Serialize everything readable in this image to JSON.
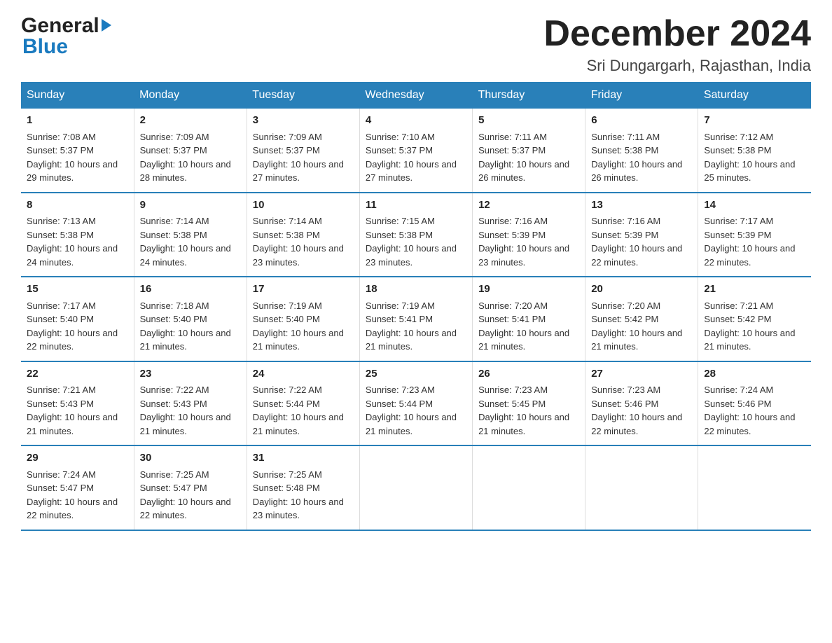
{
  "logo": {
    "line1": "General",
    "line2": "Blue"
  },
  "title": "December 2024",
  "location": "Sri Dungargarh, Rajasthan, India",
  "weekdays": [
    "Sunday",
    "Monday",
    "Tuesday",
    "Wednesday",
    "Thursday",
    "Friday",
    "Saturday"
  ],
  "weeks": [
    [
      {
        "day": "1",
        "sunrise": "7:08 AM",
        "sunset": "5:37 PM",
        "daylight": "10 hours and 29 minutes."
      },
      {
        "day": "2",
        "sunrise": "7:09 AM",
        "sunset": "5:37 PM",
        "daylight": "10 hours and 28 minutes."
      },
      {
        "day": "3",
        "sunrise": "7:09 AM",
        "sunset": "5:37 PM",
        "daylight": "10 hours and 27 minutes."
      },
      {
        "day": "4",
        "sunrise": "7:10 AM",
        "sunset": "5:37 PM",
        "daylight": "10 hours and 27 minutes."
      },
      {
        "day": "5",
        "sunrise": "7:11 AM",
        "sunset": "5:37 PM",
        "daylight": "10 hours and 26 minutes."
      },
      {
        "day": "6",
        "sunrise": "7:11 AM",
        "sunset": "5:38 PM",
        "daylight": "10 hours and 26 minutes."
      },
      {
        "day": "7",
        "sunrise": "7:12 AM",
        "sunset": "5:38 PM",
        "daylight": "10 hours and 25 minutes."
      }
    ],
    [
      {
        "day": "8",
        "sunrise": "7:13 AM",
        "sunset": "5:38 PM",
        "daylight": "10 hours and 24 minutes."
      },
      {
        "day": "9",
        "sunrise": "7:14 AM",
        "sunset": "5:38 PM",
        "daylight": "10 hours and 24 minutes."
      },
      {
        "day": "10",
        "sunrise": "7:14 AM",
        "sunset": "5:38 PM",
        "daylight": "10 hours and 23 minutes."
      },
      {
        "day": "11",
        "sunrise": "7:15 AM",
        "sunset": "5:38 PM",
        "daylight": "10 hours and 23 minutes."
      },
      {
        "day": "12",
        "sunrise": "7:16 AM",
        "sunset": "5:39 PM",
        "daylight": "10 hours and 23 minutes."
      },
      {
        "day": "13",
        "sunrise": "7:16 AM",
        "sunset": "5:39 PM",
        "daylight": "10 hours and 22 minutes."
      },
      {
        "day": "14",
        "sunrise": "7:17 AM",
        "sunset": "5:39 PM",
        "daylight": "10 hours and 22 minutes."
      }
    ],
    [
      {
        "day": "15",
        "sunrise": "7:17 AM",
        "sunset": "5:40 PM",
        "daylight": "10 hours and 22 minutes."
      },
      {
        "day": "16",
        "sunrise": "7:18 AM",
        "sunset": "5:40 PM",
        "daylight": "10 hours and 21 minutes."
      },
      {
        "day": "17",
        "sunrise": "7:19 AM",
        "sunset": "5:40 PM",
        "daylight": "10 hours and 21 minutes."
      },
      {
        "day": "18",
        "sunrise": "7:19 AM",
        "sunset": "5:41 PM",
        "daylight": "10 hours and 21 minutes."
      },
      {
        "day": "19",
        "sunrise": "7:20 AM",
        "sunset": "5:41 PM",
        "daylight": "10 hours and 21 minutes."
      },
      {
        "day": "20",
        "sunrise": "7:20 AM",
        "sunset": "5:42 PM",
        "daylight": "10 hours and 21 minutes."
      },
      {
        "day": "21",
        "sunrise": "7:21 AM",
        "sunset": "5:42 PM",
        "daylight": "10 hours and 21 minutes."
      }
    ],
    [
      {
        "day": "22",
        "sunrise": "7:21 AM",
        "sunset": "5:43 PM",
        "daylight": "10 hours and 21 minutes."
      },
      {
        "day": "23",
        "sunrise": "7:22 AM",
        "sunset": "5:43 PM",
        "daylight": "10 hours and 21 minutes."
      },
      {
        "day": "24",
        "sunrise": "7:22 AM",
        "sunset": "5:44 PM",
        "daylight": "10 hours and 21 minutes."
      },
      {
        "day": "25",
        "sunrise": "7:23 AM",
        "sunset": "5:44 PM",
        "daylight": "10 hours and 21 minutes."
      },
      {
        "day": "26",
        "sunrise": "7:23 AM",
        "sunset": "5:45 PM",
        "daylight": "10 hours and 21 minutes."
      },
      {
        "day": "27",
        "sunrise": "7:23 AM",
        "sunset": "5:46 PM",
        "daylight": "10 hours and 22 minutes."
      },
      {
        "day": "28",
        "sunrise": "7:24 AM",
        "sunset": "5:46 PM",
        "daylight": "10 hours and 22 minutes."
      }
    ],
    [
      {
        "day": "29",
        "sunrise": "7:24 AM",
        "sunset": "5:47 PM",
        "daylight": "10 hours and 22 minutes."
      },
      {
        "day": "30",
        "sunrise": "7:25 AM",
        "sunset": "5:47 PM",
        "daylight": "10 hours and 22 minutes."
      },
      {
        "day": "31",
        "sunrise": "7:25 AM",
        "sunset": "5:48 PM",
        "daylight": "10 hours and 23 minutes."
      },
      null,
      null,
      null,
      null
    ]
  ],
  "labels": {
    "sunrise": "Sunrise:",
    "sunset": "Sunset:",
    "daylight": "Daylight:"
  }
}
